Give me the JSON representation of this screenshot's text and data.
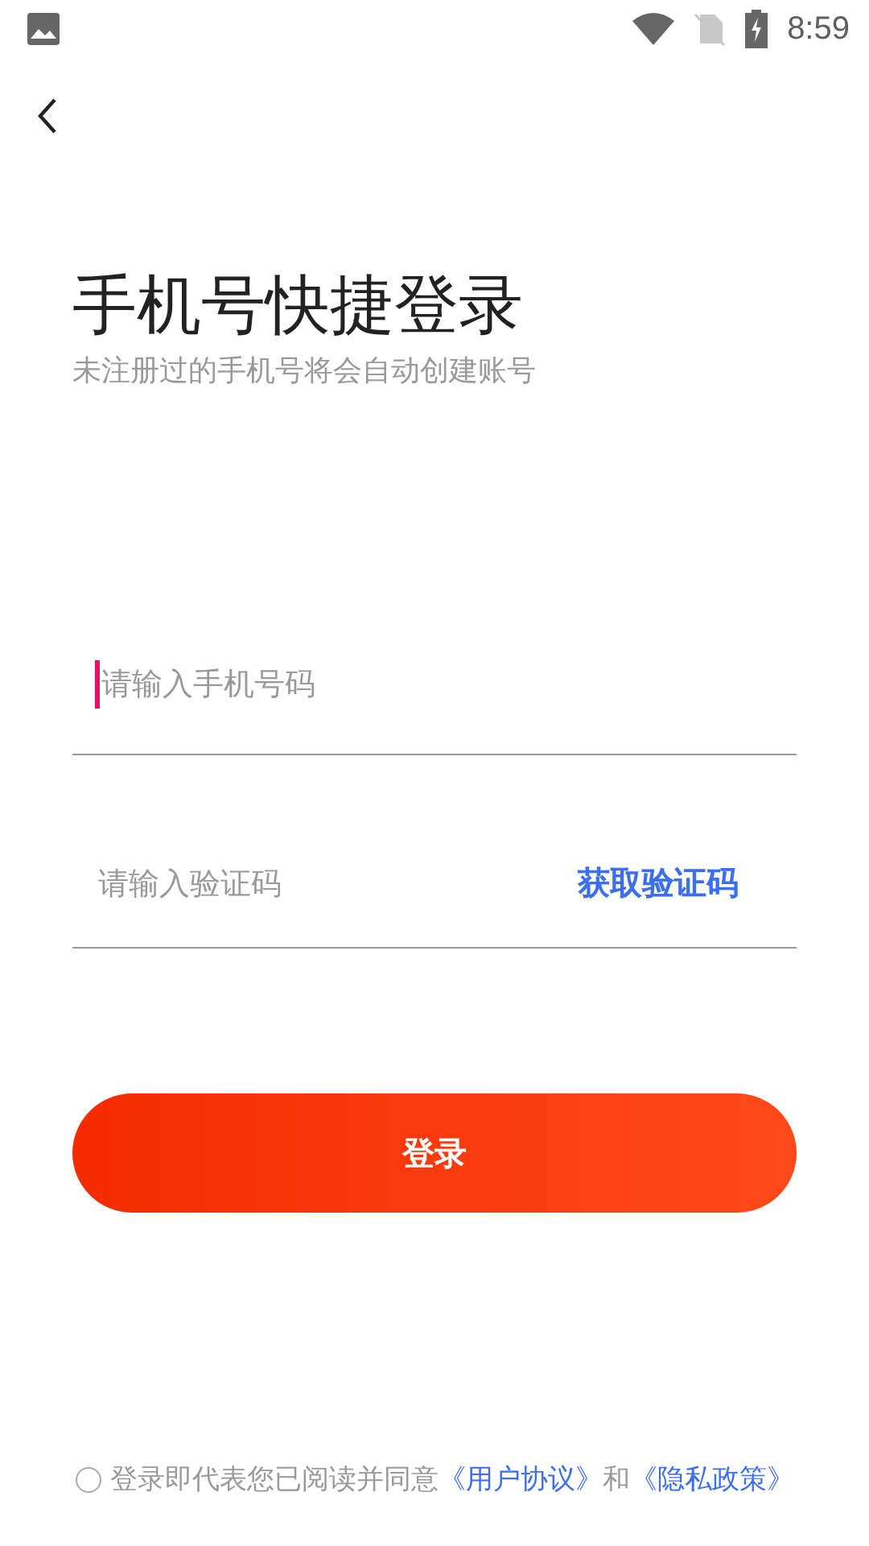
{
  "status_bar": {
    "time": "8:59"
  },
  "title": "手机号快捷登录",
  "subtitle": "未注册过的手机号将会自动创建账号",
  "fields": [
    {
      "kind": "phone",
      "placeholder": "请输入手机号码",
      "focused": true
    },
    {
      "kind": "code",
      "placeholder": "请输入验证码",
      "focused": false,
      "action": "获取验证码"
    }
  ],
  "login_button": "登录",
  "agreement": {
    "checked": false,
    "text": "登录即代表您已阅读并同意",
    "links": [
      "《用户协议》",
      "《隐私政策》"
    ],
    "joiner": "和"
  }
}
